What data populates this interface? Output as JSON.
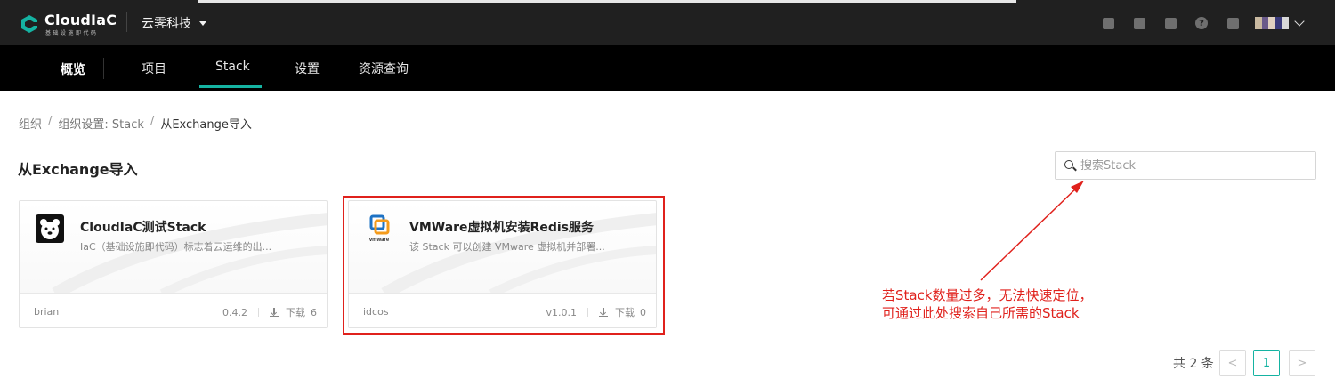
{
  "header": {
    "logo_text": "CloudIaC",
    "logo_sub": "基础设施即代码",
    "org_name": "云霁科技"
  },
  "nav": {
    "overview": "概览",
    "items": [
      "项目",
      "Stack",
      "设置",
      "资源查询"
    ],
    "active": "Stack"
  },
  "breadcrumb": [
    "组织",
    "组织设置: Stack",
    "从Exchange导入"
  ],
  "page_title": "从Exchange导入",
  "search": {
    "placeholder": "搜索Stack",
    "value": ""
  },
  "cards": [
    {
      "title": "CloudIaC测试Stack",
      "desc": "IaC（基础设施即代码）标志着云运维的出...",
      "author": "brian",
      "version": "0.4.2",
      "downloads_label": "下载",
      "downloads": "6",
      "icon": "bear-icon"
    },
    {
      "title": "VMWare虚拟机安装Redis服务",
      "desc": "该 Stack 可以创建 VMware 虚拟机并部署...",
      "author": "idcos",
      "version": "v1.0.1",
      "downloads_label": "下载",
      "downloads": "0",
      "icon": "vmware-icon"
    }
  ],
  "annotation": {
    "line1": "若Stack数量过多，无法快速定位，",
    "line2": "可通过此处搜索自己所需的Stack",
    "color": "#e0211c"
  },
  "pagination": {
    "total": "共 2 条",
    "current": "1",
    "prev": "<",
    "next": ">"
  },
  "colors": {
    "accent": "#15b3a2",
    "topbar": "#202020",
    "navbar": "#000000"
  }
}
